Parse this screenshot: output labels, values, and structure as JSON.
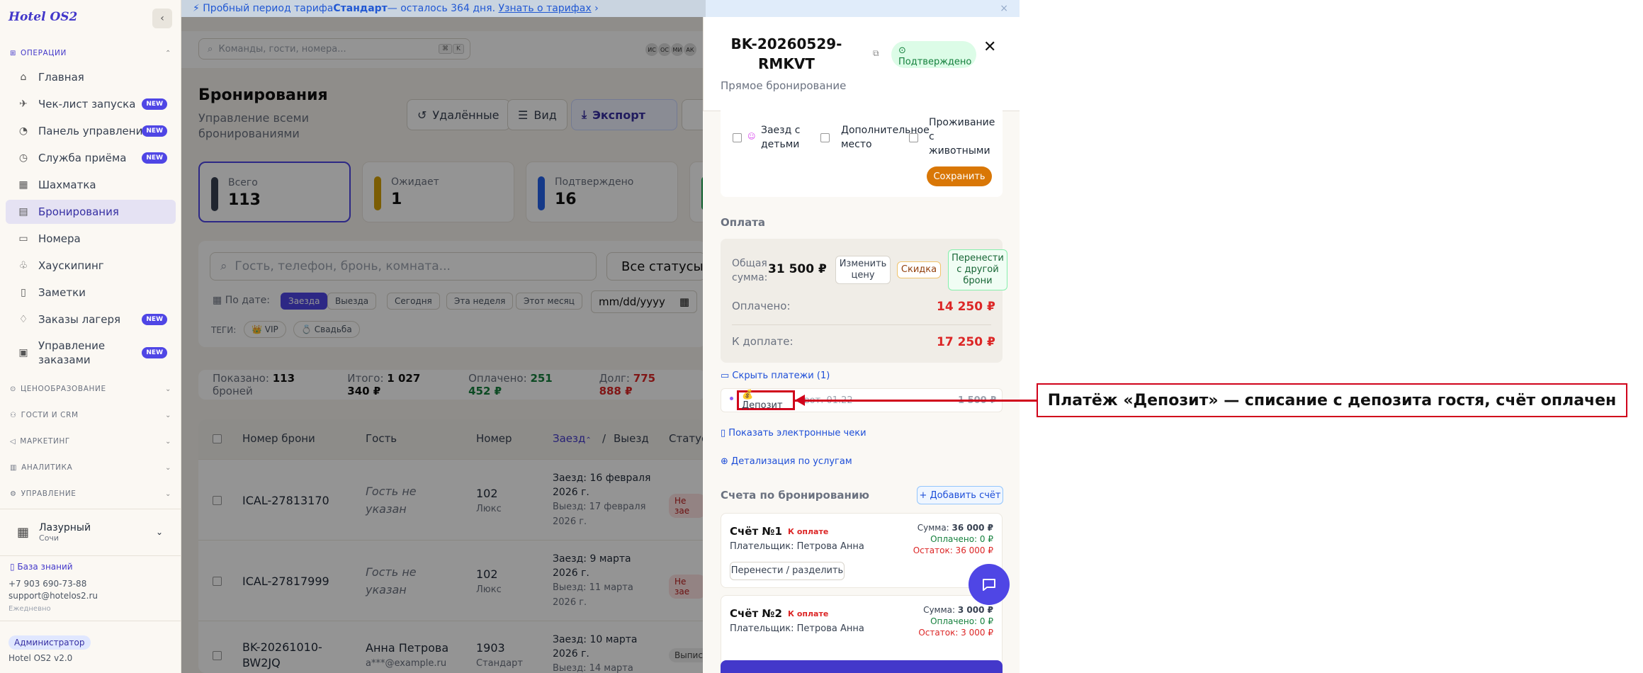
{
  "brand": "Hotel OS2",
  "banner": {
    "pre": "Пробный период тарифа ",
    "plan": "Стандарт",
    "post": " — осталось 364 дня.",
    "link": "Узнать о тарифах",
    "close": "×"
  },
  "sidebar": {
    "sec_ops": "ОПЕРАЦИИ",
    "items": [
      {
        "label": "Главная",
        "icon": "⌂",
        "new": ""
      },
      {
        "label": "Чек-лист запуска",
        "icon": "✈",
        "new": "NEW"
      },
      {
        "label": "Панель управления",
        "icon": "◔",
        "new": "NEW"
      },
      {
        "label": "Служба приёма",
        "icon": "◷",
        "new": "NEW"
      },
      {
        "label": "Шахматка",
        "icon": "▦",
        "new": ""
      },
      {
        "label": "Бронирования",
        "icon": "▤",
        "new": ""
      },
      {
        "label": "Номера",
        "icon": "▭",
        "new": ""
      },
      {
        "label": "Хаускипинг",
        "icon": "♧",
        "new": ""
      },
      {
        "label": "Заметки",
        "icon": "▯",
        "new": ""
      },
      {
        "label": "Заказы лагеря",
        "icon": "♢",
        "new": "NEW"
      },
      {
        "label": "Управление",
        "label2": "заказами",
        "icon": "▣",
        "new": "NEW"
      }
    ],
    "sections": [
      "ЦЕНООБРАЗОВАНИЕ",
      "ГОСТИ И CRM",
      "МАРКЕТИНГ",
      "АНАЛИТИКА",
      "УПРАВЛЕНИЕ"
    ],
    "hotel": {
      "name": "Лазурный",
      "city": "Сочи"
    },
    "kb": "База знаний",
    "phone": "+7 903 690-73-88",
    "email": "support@hotelos2.ru",
    "daily": "Ежедневно",
    "role": "Администратор",
    "version": "Hotel OS2 v2.0"
  },
  "topbar": {
    "search_placeholder": "Команды, гости, номера...",
    "k1": "⌘",
    "k2": "K",
    "avatars": [
      "ИС",
      "ОС",
      "МИ",
      "АК"
    ]
  },
  "page": {
    "title": "Бронирования",
    "subtitle": "Управление всеми бронированиями",
    "btn_deleted": "Удалённые",
    "btn_view": "Вид",
    "btn_export": "Экспорт"
  },
  "stats": [
    {
      "label": "Всего",
      "value": "113",
      "color": "#374151"
    },
    {
      "label": "Ожидает",
      "value": "1",
      "color": "#d4a106"
    },
    {
      "label": "Подтверждено",
      "value": "16",
      "color": "#2563eb"
    }
  ],
  "filters": {
    "search_placeholder": "Гость, телефон, бронь, комната...",
    "status": "Все статусы",
    "by_date": "По дате:",
    "chips": [
      "Заезда",
      "Выезда",
      "Сегодня",
      "Эта неделя",
      "Этот месяц"
    ],
    "date_placeholder": "mm/dd/yyyy",
    "tags_label": "ТЕГИ:",
    "tags": [
      "👑 VIP",
      "💍 Свадьба"
    ]
  },
  "summary": {
    "shown_l": "Показано:",
    "shown_v": "113",
    "shown_s": "броней",
    "total_l": "Итого:",
    "total_v": "1 027 340 ₽",
    "paid_l": "Оплачено:",
    "paid_v": "251 452 ₽",
    "debt_l": "Долг:",
    "debt_v": "775 888 ₽"
  },
  "table": {
    "headers": {
      "num": "Номер брони",
      "guest": "Гость",
      "room": "Номер",
      "checkin": "Заезд",
      "sep": "/",
      "checkout": "Выезд",
      "status": "Статус"
    },
    "rows": [
      {
        "num": "ICAL-27813170",
        "guest1": "Гость не",
        "guest2": "указан",
        "room": "102",
        "type": "Люкс",
        "in1": "Заезд: 16 февраля",
        "in2": "2026 г.",
        "out1": "Выезд: 17 февраля",
        "out2": "2026 г.",
        "status": "Не зае"
      },
      {
        "num": "ICAL-27817999",
        "guest1": "Гость не",
        "guest2": "указан",
        "room": "102",
        "type": "Люкс",
        "in1": "Заезд: 9 марта",
        "in2": "2026 г.",
        "out1": "Выезд: 11 марта",
        "out2": "2026 г.",
        "status": "Не зае"
      },
      {
        "num": "BK-20261010-",
        "num2": "BW2JQ",
        "guest1": "Анна Петрова",
        "guest2": "a***@example.ru",
        "room": "1903",
        "type": "Стандарт",
        "in1": "Заезд: 10 марта",
        "in2": "2026 г.",
        "out1": "Выезд: 14 марта",
        "out2": "",
        "status": "Выписа"
      }
    ]
  },
  "drawer": {
    "title1": "BK-20260529-",
    "title2": "RMKVT",
    "status": "Подтверждено",
    "close": "✕",
    "subtitle": "Прямое бронирование",
    "options": [
      {
        "l1": "Заезд с",
        "l2": "детьми"
      },
      {
        "l1": "Дополнительное",
        "l2": "место"
      },
      {
        "l1": "Проживание",
        "l2": "с",
        "l3": "животными"
      }
    ],
    "save": "Сохранить",
    "payment_header": "Оплата",
    "total_l1": "Общая",
    "total_l2": "сумма:",
    "total_v": "31 500 ₽",
    "change_price": "Изменить цену",
    "discount": "Скидка",
    "transfer": "Перенести с другой брони",
    "paid_l": "Оплачено:",
    "paid_v": "14 250 ₽",
    "due_l": "К доплате:",
    "due_v": "17 250 ₽",
    "hide_payments": "Скрыть платежи (1)",
    "deposit": "💰 Депозит",
    "pay_date": "вот. 01.22",
    "pay_amount": "1 500 ₽",
    "show_receipts": "Показать электронные чеки",
    "service_detail": "Детализация по услугам",
    "invoices_header": "Счета по бронированию",
    "add_invoice": "+ Добавить счёт",
    "invoices": [
      {
        "title": "Счёт №1",
        "badge": "К оплате",
        "payer": "Плательщик: Петрова Анна",
        "sum_l": "Сумма:",
        "sum_v": "36 000 ₽",
        "paid": "Оплачено: 0 ₽",
        "rest": "Остаток: 36 000 ₽",
        "btn": "Перенести / разделить"
      },
      {
        "title": "Счёт №2",
        "badge": "К оплате",
        "payer": "Плательщик: Петрова Анна",
        "sum_l": "Сумма:",
        "sum_v": "3 000 ₽",
        "paid": "Оплачено: 0 ₽",
        "rest": "Остаток: 3 000 ₽"
      }
    ]
  },
  "annotation": "Платёж «Депозит» — списание с депозита гостя, счёт оплачен"
}
